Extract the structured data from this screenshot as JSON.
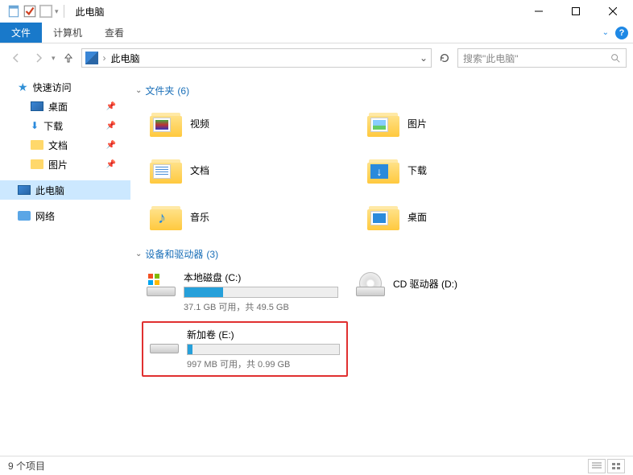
{
  "window": {
    "title": "此电脑"
  },
  "ribbon": {
    "file": "文件",
    "computer": "计算机",
    "view": "查看"
  },
  "address": {
    "location": "此电脑"
  },
  "search": {
    "placeholder": "搜索\"此电脑\""
  },
  "sidebar": {
    "quick": "快速访问",
    "desktop": "桌面",
    "downloads": "下载",
    "documents": "文档",
    "pictures": "图片",
    "thispc": "此电脑",
    "network": "网络"
  },
  "sections": {
    "folders": {
      "label": "文件夹",
      "count": "(6)"
    },
    "drives": {
      "label": "设备和驱动器",
      "count": "(3)"
    }
  },
  "folders": {
    "videos": "视频",
    "pictures": "图片",
    "documents": "文档",
    "downloads": "下载",
    "music": "音乐",
    "desktop": "桌面"
  },
  "drives": {
    "c": {
      "name": "本地磁盘 (C:)",
      "status": "37.1 GB 可用，共 49.5 GB",
      "fillpct": 25
    },
    "d": {
      "name": "CD 驱动器 (D:)"
    },
    "e": {
      "name": "新加卷 (E:)",
      "status": "997 MB 可用，共 0.99 GB",
      "fillpct": 3
    }
  },
  "statusbar": {
    "count": "9 个项目"
  }
}
